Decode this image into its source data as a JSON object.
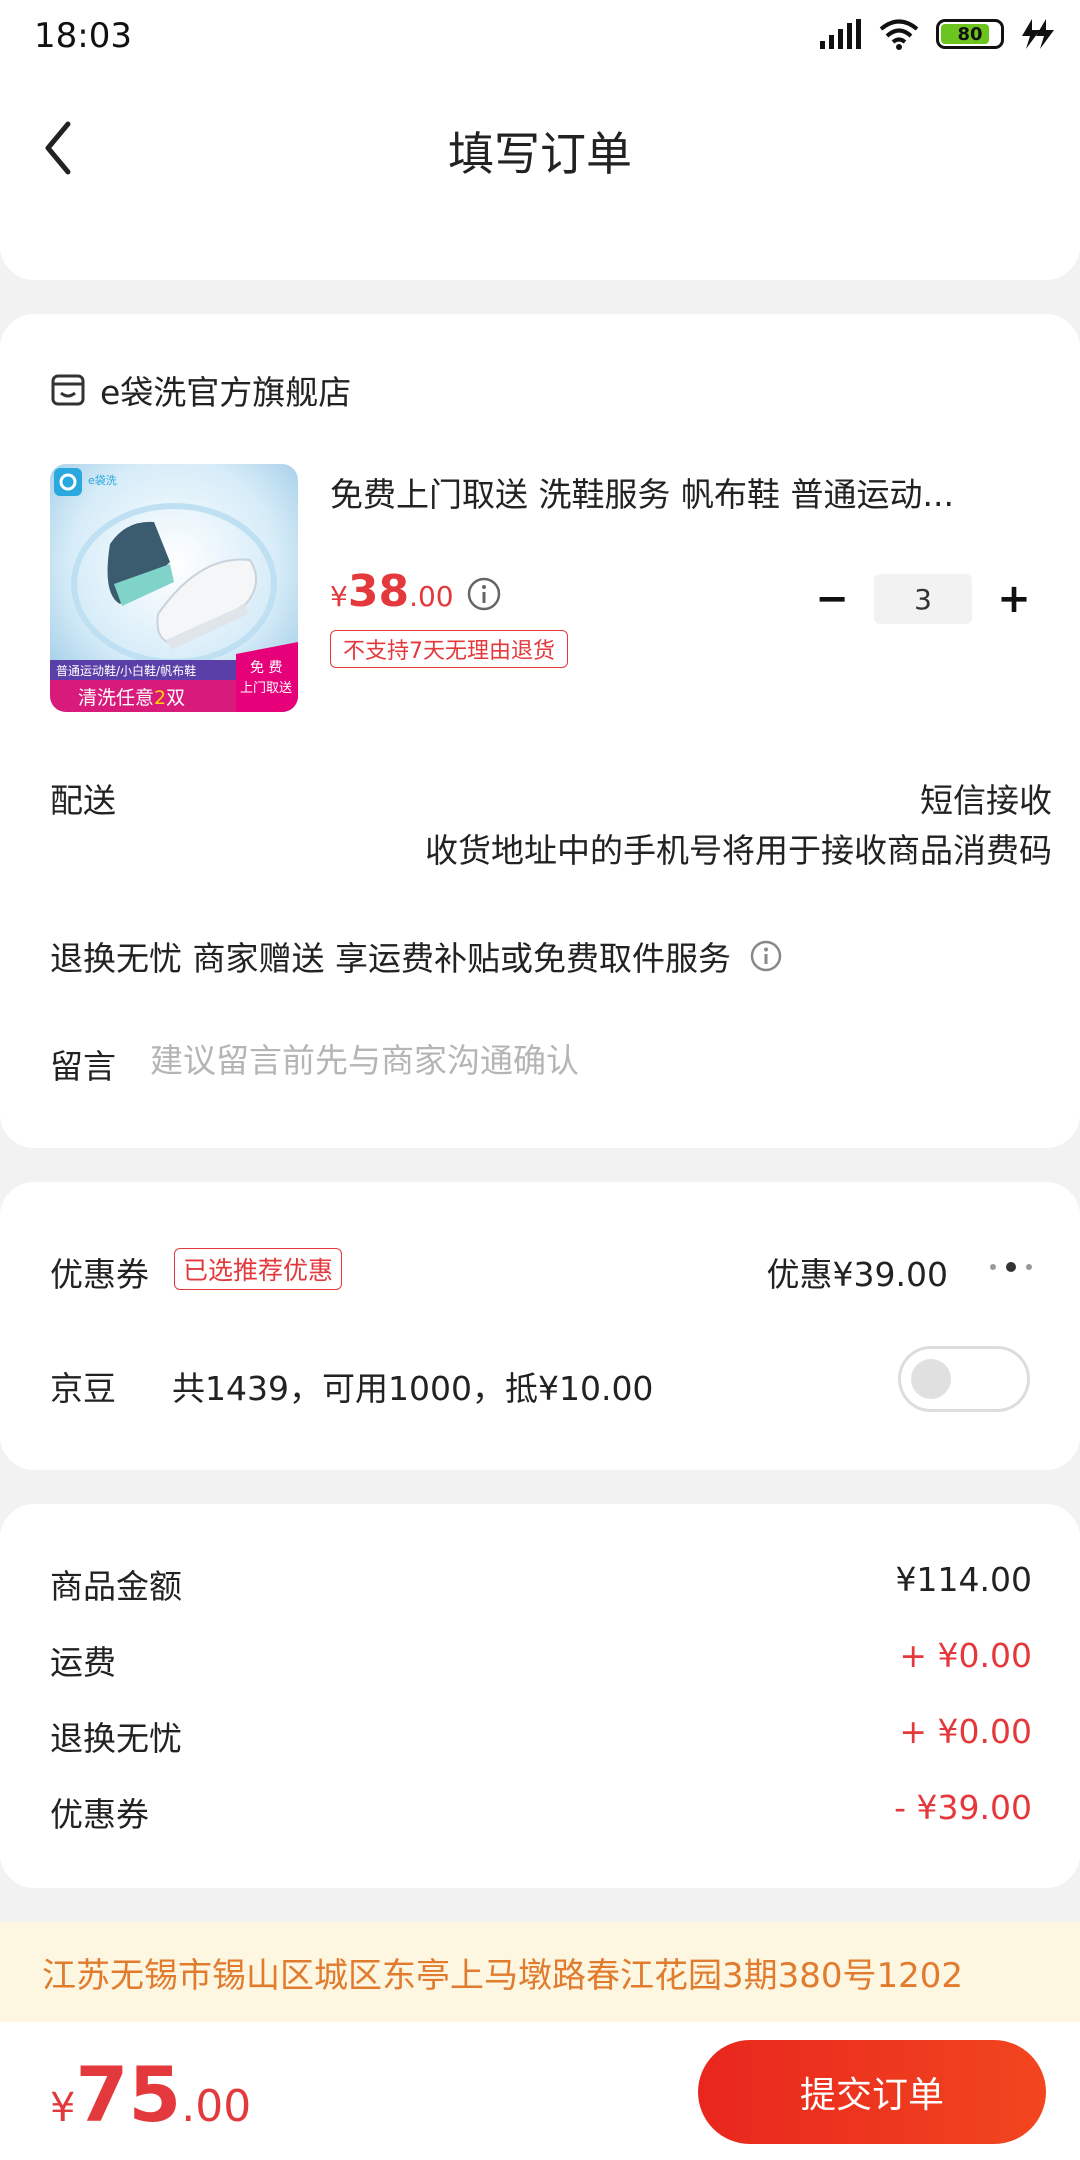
{
  "status_bar": {
    "time": "18:03",
    "battery": "80"
  },
  "header": {
    "title": "填写订单"
  },
  "shop": {
    "name": "e袋洗官方旗舰店"
  },
  "product": {
    "title": "免费上门取送 洗鞋服务  帆布鞋  普通运动...",
    "price_yen": "¥",
    "price_int": "38",
    "price_dec": ".00",
    "return_note": "不支持7天无理由退货",
    "quantity": "3",
    "image": {
      "brand": "e袋洗",
      "tags": "普通运动鞋/小白鞋/帆布鞋",
      "promo_prefix": "清洗任意",
      "promo_num": "2",
      "promo_suffix": "双",
      "free_line1": "免 费",
      "free_line2": "上门取送"
    }
  },
  "delivery": {
    "label": "配送",
    "value": "短信接收",
    "note": "收货地址中的手机号将用于接收商品消费码"
  },
  "worry_free": {
    "text": "退换无忧 商家赠送  享运费补贴或免费取件服务"
  },
  "message": {
    "label": "留言",
    "placeholder": "建议留言前先与商家沟通确认"
  },
  "coupon": {
    "label": "优惠券",
    "badge": "已选推荐优惠",
    "value": "优惠¥39.00"
  },
  "jd_beans": {
    "label": "京豆",
    "info": "共1439，可用1000，抵¥10.00",
    "enabled": false
  },
  "summary": [
    {
      "label": "商品金额",
      "value": "¥114.00"
    },
    {
      "label": "运费",
      "value": "+ ¥0.00"
    },
    {
      "label": "退换无忧",
      "value": "+ ¥0.00"
    },
    {
      "label": "优惠券",
      "value": "- ¥39.00"
    }
  ],
  "address": "江苏无锡市锡山区城区东亭上马墩路春江花园3期380号1202",
  "total": {
    "yen": "¥",
    "int": "75",
    "dec": ".00"
  },
  "submit": {
    "label": "提交订单"
  },
  "colors": {
    "accent": "#e4393c",
    "address_text": "#e17b2e",
    "address_bg": "#fdf6e0"
  }
}
